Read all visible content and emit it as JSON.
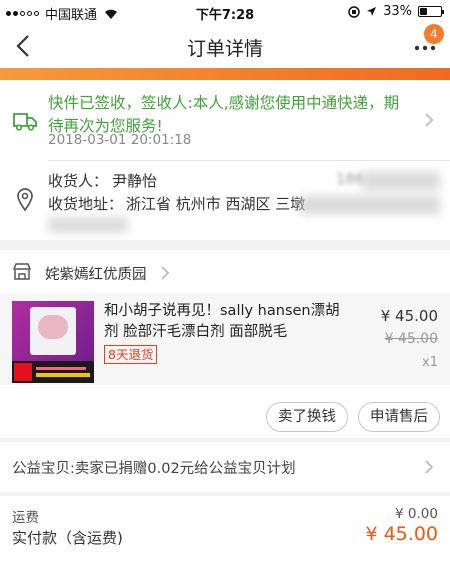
{
  "status_bar": {
    "carrier": "中国联通",
    "time": "下午7:28",
    "battery": "33%",
    "battery_level": 0.33
  },
  "nav": {
    "title": "订单详情",
    "badge_count": "4"
  },
  "logistics": {
    "status": "快件已签收，签收人:本人,感谢您使用中通快递，期待再次为您服务!",
    "time": "2018-03-01 20:01:18"
  },
  "receiver": {
    "name_label": "收货人：",
    "name": "尹静怡",
    "phone": "186",
    "address_label": "收货地址：",
    "address": "浙江省 杭州市 西湖区 三墩"
  },
  "shop": {
    "name": "姹紫嫣红优质园"
  },
  "product": {
    "title": "和小胡子说再见！sally hansen漂胡剂 脸部汗毛漂白剂  面部脱毛",
    "return_policy": "8天退货",
    "price": "¥ 45.00",
    "original_price": "¥ 45.00",
    "quantity": "x1"
  },
  "actions": {
    "sell_button": "卖了换钱",
    "after_sale_button": "申请售后"
  },
  "charity": {
    "text": "公益宝贝:卖家已捐赠0.02元给公益宝贝计划"
  },
  "summary": {
    "shipping_label": "运费",
    "shipping_value": "¥ 0.00",
    "paid_label": "实付款（含运费)",
    "paid_value": "¥ 45.00"
  },
  "colors": {
    "accent_orange": "#f16a1f",
    "status_green": "#3fa437",
    "price_orange": "#f15a0a"
  }
}
